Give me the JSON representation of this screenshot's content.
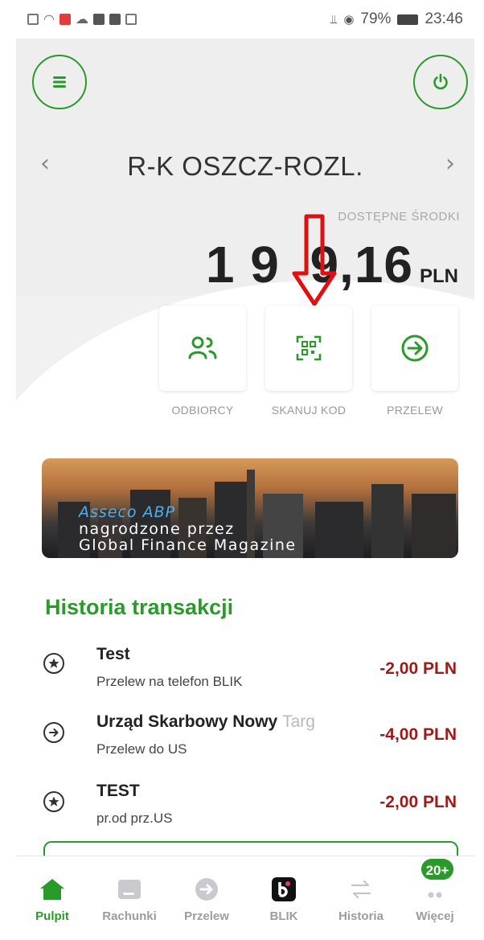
{
  "status_bar": {
    "battery": "79%",
    "time": "23:46"
  },
  "account": {
    "name": "R-K OSZCZ-ROZL.",
    "available_label": "DOSTĘPNE ŚRODKI",
    "balance": "1 9  9,16",
    "currency": "PLN"
  },
  "quick_actions": [
    {
      "label": "ODBIORCY",
      "icon": "recipients-icon"
    },
    {
      "label": "SKANUJ KOD",
      "icon": "qr-scan-icon"
    },
    {
      "label": "PRZELEW",
      "icon": "arrow-right-circle-icon"
    }
  ],
  "banner": {
    "line1": "Asseco ABP",
    "line2": "nagrodzone przez",
    "line3": "Global Finance Magazine"
  },
  "history": {
    "title": "Historia transakcji",
    "items": [
      {
        "title": "Test",
        "title_faded": "",
        "subtitle": "Przelew na telefon BLIK",
        "amount": "-2,00 PLN",
        "icon": "star-circle-icon"
      },
      {
        "title": "Urząd Skarbowy Nowy ",
        "title_faded": "Targ",
        "subtitle": "Przelew do US",
        "amount": "-4,00 PLN",
        "icon": "arrow-right-circle-icon"
      },
      {
        "title": "TEST",
        "title_faded": "",
        "subtitle": "pr.od prz.US",
        "amount": "-2,00 PLN",
        "icon": "star-circle-icon"
      }
    ]
  },
  "bottom_nav": {
    "items": [
      {
        "label": "Pulpit",
        "icon": "home-icon",
        "active": true
      },
      {
        "label": "Rachunki",
        "icon": "wallet-icon",
        "active": false
      },
      {
        "label": "Przelew",
        "icon": "arrow-right-circle-icon",
        "active": false
      },
      {
        "label": "BLIK",
        "icon": "blik-icon",
        "active": false
      },
      {
        "label": "Historia",
        "icon": "swap-arrows-icon",
        "active": false
      },
      {
        "label": "Więcej",
        "icon": "more-dots-icon",
        "active": false
      }
    ],
    "badge": "20+"
  },
  "colors": {
    "accent": "#2a9a2a",
    "negative": "#9b1b1b",
    "indicator": "#e01010"
  }
}
